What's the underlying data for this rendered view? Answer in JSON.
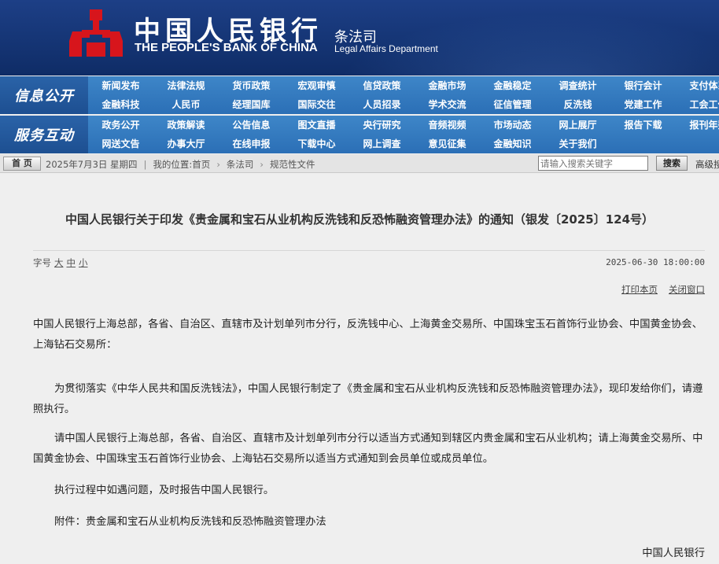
{
  "header": {
    "bank_name_cn": "中国人民银行",
    "bank_name_en": "THE PEOPLE'S BANK OF CHINA",
    "dept_cn": "条法司",
    "dept_en": "Legal Affairs Department",
    "colors": {
      "banner": "#153575",
      "logo_red": "#d7151c",
      "nav": "#2b6fb6"
    }
  },
  "nav": {
    "info_title": "信息公开",
    "service_title": "服务互动",
    "info_row1": [
      "新闻发布",
      "法律法规",
      "货币政策",
      "宏观审慎",
      "信贷政策",
      "金融市场",
      "金融稳定",
      "调查统计",
      "银行会计",
      "支付体系"
    ],
    "info_row2": [
      "金融科技",
      "人民币",
      "经理国库",
      "国际交往",
      "人员招录",
      "学术交流",
      "征信管理",
      "反洗钱",
      "党建工作",
      "工会工作"
    ],
    "service_row1": [
      "政务公开",
      "政策解读",
      "公告信息",
      "图文直播",
      "央行研究",
      "音频视频",
      "市场动态",
      "网上展厅",
      "报告下载",
      "报刊年鉴"
    ],
    "service_row2": [
      "网送文告",
      "办事大厅",
      "在线申报",
      "下载中心",
      "网上调查",
      "意见征集",
      "金融知识",
      "关于我们"
    ]
  },
  "breadcrumb": {
    "home": "首 页",
    "date": "2025年7月3日 星期四",
    "location_label": "我的位置:首页",
    "level1": "条法司",
    "level2": "规范性文件",
    "search_placeholder": "请输入搜索关键字",
    "search_button": "搜索",
    "advanced": "高级搜索"
  },
  "article": {
    "title": "中国人民银行关于印发《贵金属和宝石从业机构反洗钱和反恐怖融资管理办法》的通知（银发〔2025〕124号）",
    "font_label": "字号",
    "font_large": "大",
    "font_medium": "中",
    "font_small": "小",
    "datetime": "2025-06-30 18:00:00",
    "print": "打印本页",
    "close": "关闭窗口",
    "recipients": "中国人民银行上海总部，各省、自治区、直辖市及计划单列市分行，反洗钱中心、上海黄金交易所、中国珠宝玉石首饰行业协会、中国黄金协会、上海钻石交易所：",
    "para1": "为贯彻落实《中华人民共和国反洗钱法》，中国人民银行制定了《贵金属和宝石从业机构反洗钱和反恐怖融资管理办法》，现印发给你们，请遵照执行。",
    "para2": "请中国人民银行上海总部，各省、自治区、直辖市及计划单列市分行以适当方式通知到辖区内贵金属和宝石从业机构；请上海黄金交易所、中国黄金协会、中国珠宝玉石首饰行业协会、上海钻石交易所以适当方式通知到会员单位或成员单位。",
    "para3": "执行过程中如遇问题，及时报告中国人民银行。",
    "attachment": "附件：贵金属和宝石从业机构反洗钱和反恐怖融资管理办法",
    "signature": "中国人民银行"
  }
}
